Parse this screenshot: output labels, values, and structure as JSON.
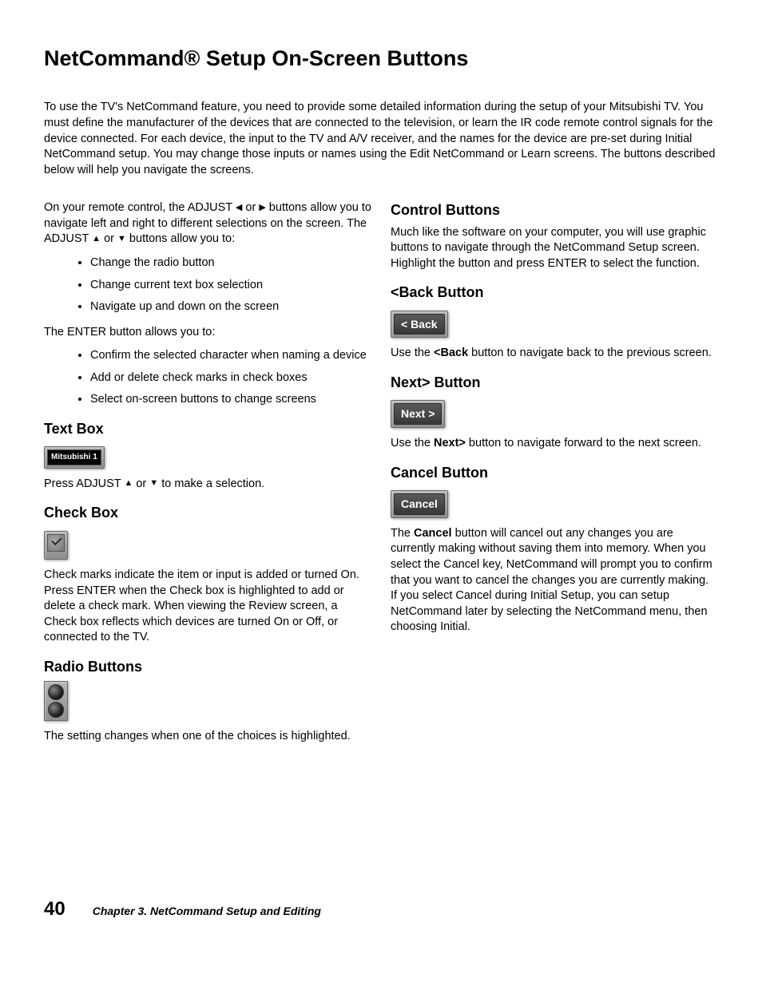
{
  "title": "NetCommand® Setup On-Screen Buttons",
  "intro": "To use the TV's NetCommand feature, you need to provide some detailed information during the setup of your Mitsubishi TV.  You must define the manufacturer of the devices that are connected to the television, or learn the IR code remote control signals for the device connected.  For each device, the input to the TV and A/V receiver, and the names for the device are pre-set during Initial NetCommand setup.  You may change those inputs or names using the Edit NetCommand or Learn screens.  The buttons described below will help you navigate the screens.",
  "left": {
    "adjust_intro_pre": "On your remote control, the ADJUST ",
    "adjust_intro_mid": " or ",
    "adjust_intro_post": " buttons allow you to navigate left and right to different selections on the screen. The ADJUST ",
    "adjust_intro_mid2": " or ",
    "adjust_intro_tail": " buttons allow you to:",
    "adjust_list": [
      "Change the radio button",
      "Change current text box selection",
      "Navigate up and down on the screen"
    ],
    "enter_intro": "The ENTER button allows you to:",
    "enter_list": [
      "Confirm the selected character when naming a device",
      "Add or delete check marks in check boxes",
      "Select on-screen buttons to change screens"
    ],
    "textbox_heading": "Text Box",
    "textbox_label": "Mitsubishi 1",
    "textbox_desc_pre": "Press ADJUST ",
    "textbox_desc_mid": " or ",
    "textbox_desc_post": " to make a selection.",
    "checkbox_heading": "Check Box",
    "checkbox_desc": "Check marks indicate the item or input is added or turned On.  Press ENTER when the Check box is highlighted to add or delete a check mark. When viewing the Review screen, a Check box reflects which devices are turned On or Off, or connected to the TV.",
    "radio_heading": "Radio Buttons",
    "radio_desc": "The setting changes when one of the choices is highlighted."
  },
  "right": {
    "control_heading": "Control Buttons",
    "control_desc": "Much like the software on your computer, you will use graphic buttons to navigate through the NetCommand Setup screen.  Highlight the button and press ENTER to select the function.",
    "back_heading": "<Back Button",
    "back_label": "< Back",
    "back_desc_pre": "Use the ",
    "back_desc_bold": "<Back",
    "back_desc_post": " button to navigate back to the previous screen.",
    "next_heading": "Next> Button",
    "next_label": "Next >",
    "next_desc_pre": "Use the ",
    "next_desc_bold": "Next>",
    "next_desc_post": " button to navigate forward to the next screen.",
    "cancel_heading": "Cancel Button",
    "cancel_label": "Cancel",
    "cancel_desc_pre": "The ",
    "cancel_desc_bold": "Cancel",
    "cancel_desc_post": " button will cancel out any changes you are currently making without saving them into memory.  When you select the Cancel key, NetCommand will prompt you to confirm that you want to cancel the changes you are currently making.  If you select Cancel during Initial Setup, you can setup NetCommand later by selecting the NetCommand menu, then choosing Initial."
  },
  "footer": {
    "page": "40",
    "chapter": "Chapter 3. NetCommand Setup and Editing"
  },
  "glyph": {
    "left": "◀",
    "right": "▶",
    "up": "▲",
    "down": "▼"
  }
}
